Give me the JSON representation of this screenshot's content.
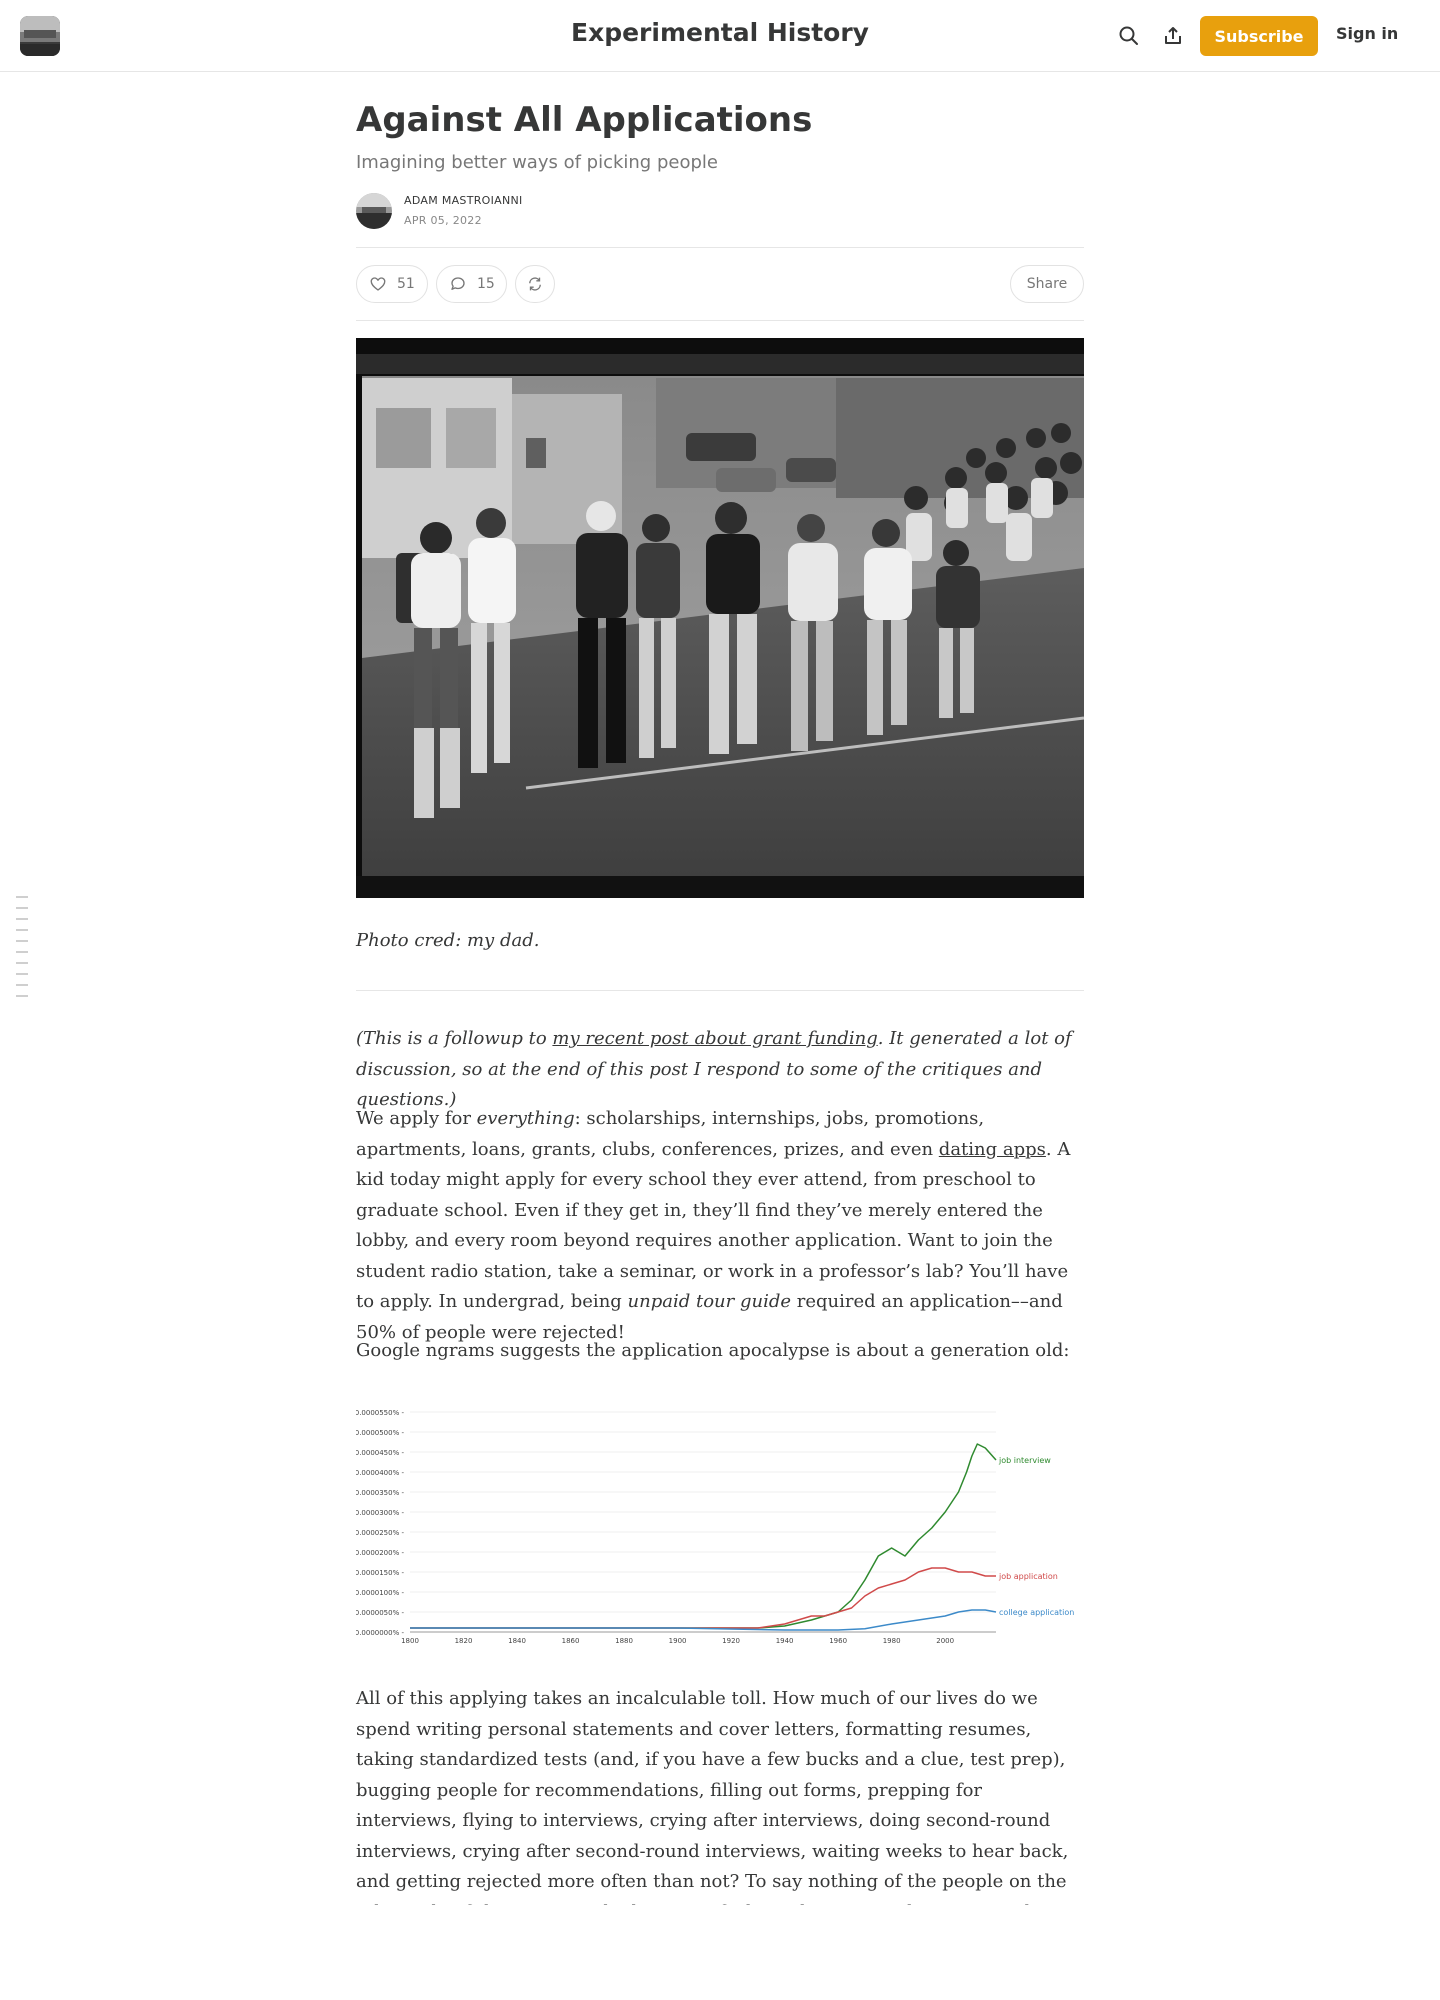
{
  "header": {
    "site_title": "Experimental History",
    "subscribe_label": "Subscribe",
    "signin_label": "Sign in",
    "icons": [
      "search-icon",
      "share-icon"
    ]
  },
  "post": {
    "title": "Against All Applications",
    "subtitle": "Imagining better ways of picking people",
    "author": "ADAM MASTROIANNI",
    "date": "APR 05, 2022",
    "likes": "51",
    "comments": "15",
    "share_label": "Share"
  },
  "hero": {
    "caption": "Photo cred: my dad."
  },
  "body": {
    "intro_pre": "(This is a followup to ",
    "intro_link": "my recent post about grant funding",
    "intro_post": ". It generated a lot of discussion, so at the end of this post I respond to some of the critiques and questions.)",
    "p1_a": "We apply for ",
    "p1_em1": "everything",
    "p1_b": ": scholarships, internships, jobs, promotions, apartments, loans, grants, clubs, conferences, prizes, and even ",
    "p1_link": "dating apps",
    "p1_c": ". A kid today might apply for every school they ever attend, from preschool to graduate school. Even if they get in, they’ll find they’ve merely entered the lobby, and every room beyond requires another application. Want to join the student radio station, take a seminar, or work in a professor’s lab? You’ll have to apply. In undergrad, being ",
    "p1_em2": "unpaid tour guide",
    "p1_d": " required an application––and 50% of people were rejected!",
    "p2": "Google ngrams suggests the application apocalypse is about a generation old:",
    "p3": "All of this applying takes an incalculable toll. How much of our lives do we spend writing personal statements and cover letters, formatting resumes, taking standardized tests (and, if you have a few bucks and a clue, test prep), bugging people for recommendations, filling out forms, prepping for interviews, flying to interviews, crying after interviews, doing second-round interviews, crying after second-round interviews, waiting weeks to hear back, and getting rejected more often than not? To say nothing of the people on the other side of the process who have to sift through every application, conduct every interview, and turn down most people. That’s a big"
  },
  "colors": {
    "accent": "#e8a00d",
    "text": "#363737",
    "muted": "#777777",
    "job_interview": "#2f8a2f",
    "job_application": "#d04a4a",
    "college_application": "#3c8ac9"
  },
  "chart_data": {
    "type": "line",
    "title": "",
    "xlabel": "",
    "ylabel": "",
    "x_ticks": [
      "1800",
      "1820",
      "1840",
      "1860",
      "1880",
      "1900",
      "1920",
      "1940",
      "1960",
      "1980",
      "2000"
    ],
    "y_ticks": [
      "0.0000000%",
      "0.0000050%",
      "0.0000100%",
      "0.0000150%",
      "0.0000200%",
      "0.0000250%",
      "0.0000300%",
      "0.0000350%",
      "0.0000400%",
      "0.0000450%",
      "0.0000500%",
      "0.0000550%"
    ],
    "xlim": [
      1800,
      2019
    ],
    "ylim": [
      0,
      5.5e-06
    ],
    "grid": true,
    "series": [
      {
        "name": "job interview",
        "color": "#2f8a2f",
        "x": [
          1800,
          1850,
          1900,
          1930,
          1940,
          1950,
          1960,
          1965,
          1970,
          1975,
          1980,
          1985,
          1990,
          1995,
          2000,
          2005,
          2008,
          2010,
          2012,
          2015,
          2019
        ],
        "y": [
          1e-07,
          1e-07,
          1e-07,
          1e-07,
          1.5e-07,
          3e-07,
          5e-07,
          8e-07,
          1.3e-06,
          1.9e-06,
          2.1e-06,
          1.9e-06,
          2.3e-06,
          2.6e-06,
          3e-06,
          3.5e-06,
          4e-06,
          4.4e-06,
          4.7e-06,
          4.6e-06,
          4.3e-06
        ]
      },
      {
        "name": "job application",
        "color": "#d04a4a",
        "x": [
          1800,
          1850,
          1900,
          1930,
          1940,
          1945,
          1950,
          1955,
          1960,
          1965,
          1970,
          1975,
          1980,
          1985,
          1990,
          1995,
          2000,
          2005,
          2010,
          2015,
          2019
        ],
        "y": [
          1e-07,
          1e-07,
          1e-07,
          1e-07,
          2e-07,
          3e-07,
          4e-07,
          4e-07,
          5e-07,
          6e-07,
          9e-07,
          1.1e-06,
          1.2e-06,
          1.3e-06,
          1.5e-06,
          1.6e-06,
          1.6e-06,
          1.5e-06,
          1.5e-06,
          1.4e-06,
          1.4e-06
        ]
      },
      {
        "name": "college application",
        "color": "#3c8ac9",
        "x": [
          1800,
          1850,
          1900,
          1940,
          1960,
          1970,
          1980,
          1990,
          2000,
          2005,
          2010,
          2015,
          2019
        ],
        "y": [
          1e-07,
          1e-07,
          1e-07,
          5e-08,
          5e-08,
          8e-08,
          2e-07,
          3e-07,
          4e-07,
          5e-07,
          5.5e-07,
          5.5e-07,
          5e-07
        ]
      }
    ]
  }
}
